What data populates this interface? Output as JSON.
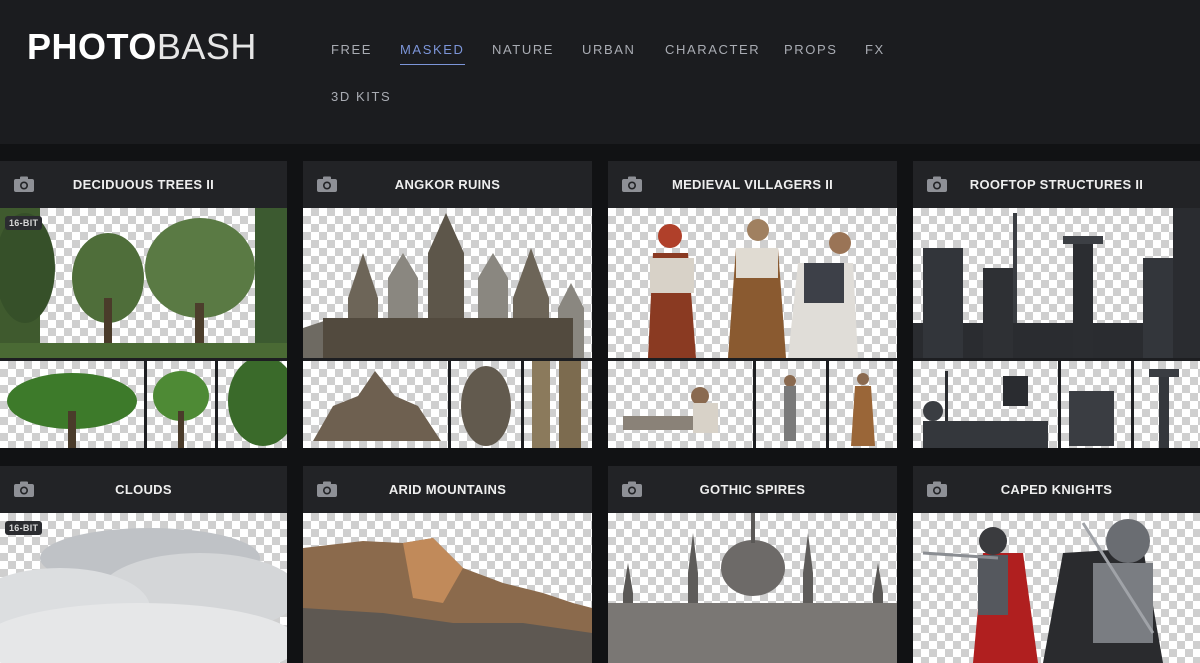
{
  "logo": {
    "bold": "PHOTO",
    "light": "BASH"
  },
  "nav": {
    "items": [
      "FREE",
      "MASKED",
      "NATURE",
      "URBAN",
      "CHARACTER",
      "PROPS",
      "FX",
      "3D KITS"
    ],
    "active": "MASKED",
    "active_color": "#7c95d8"
  },
  "cards": [
    {
      "title": "DECIDUOUS TREES II",
      "badge": "16-BIT",
      "icon": "camera-icon"
    },
    {
      "title": "ANGKOR RUINS",
      "icon": "camera-icon"
    },
    {
      "title": "MEDIEVAL VILLAGERS II",
      "icon": "camera-icon"
    },
    {
      "title": "ROOFTOP STRUCTURES II",
      "icon": "camera-icon"
    },
    {
      "title": "CLOUDS",
      "badge": "16-BIT",
      "icon": "camera-icon"
    },
    {
      "title": "ARID MOUNTAINS",
      "icon": "camera-icon"
    },
    {
      "title": "GOTHIC SPIRES",
      "icon": "camera-icon"
    },
    {
      "title": "CAPED KNIGHTS",
      "icon": "camera-icon"
    }
  ]
}
